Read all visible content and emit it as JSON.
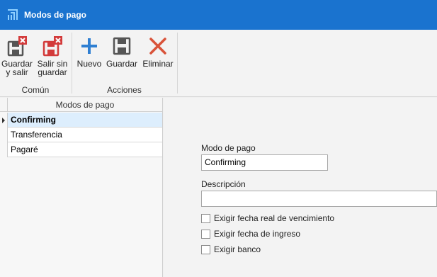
{
  "window": {
    "title": "Modos de pago"
  },
  "ribbon": {
    "groups": [
      {
        "label": "Común"
      },
      {
        "label": "Acciones"
      }
    ],
    "buttons": {
      "guardar_salir": {
        "line1": "Guardar",
        "line2": "y salir"
      },
      "salir_sin_guardar": {
        "line1": "Salir sin",
        "line2": "guardar"
      },
      "nuevo": {
        "line1": "Nuevo"
      },
      "guardar": {
        "line1": "Guardar"
      },
      "eliminar": {
        "line1": "Eliminar"
      }
    }
  },
  "grid": {
    "column_header": "Modos de pago",
    "rows": [
      "Confirming",
      "Transferencia",
      "Pagaré"
    ],
    "selected_index": 0
  },
  "form": {
    "modo_label": "Modo de pago",
    "modo_value": "Confirming",
    "descripcion_label": "Descripción",
    "descripcion_value": "",
    "checkboxes": [
      {
        "label": "Exigir fecha real de vencimiento",
        "checked": false
      },
      {
        "label": "Exigir fecha de ingreso",
        "checked": false
      },
      {
        "label": "Exigir banco",
        "checked": false
      }
    ]
  },
  "colors": {
    "titlebar": "#1a73cf",
    "selected_row": "#ddeefd",
    "save_red": "#d33b3b",
    "add_blue": "#2f7fd2",
    "delete_red": "#d9533a"
  }
}
